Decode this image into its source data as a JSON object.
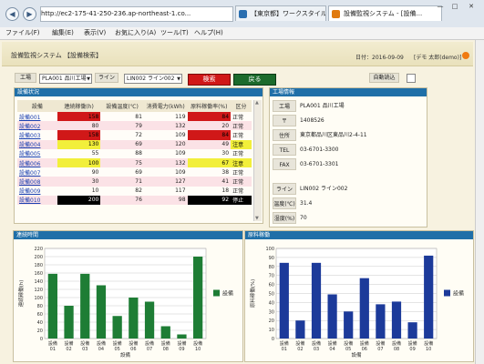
{
  "browser": {
    "address": "http://ec2-175-41-250-236.ap-northeast-1.co...",
    "tabs": [
      {
        "label": "【東京都】ワークスタイル..."
      },
      {
        "label": "設備監視システム - [設備..."
      }
    ],
    "menu": [
      "ファイル(F)",
      "編集(E)",
      "表示(V)",
      "お気に入り(A)",
      "ツール(T)",
      "ヘルプ(H)"
    ]
  },
  "header": {
    "title": "設備監視システム 【設備検索】",
    "date_label": "日付：2016-09-09",
    "user_label": "[デモ 太郎(demo)]"
  },
  "filters": {
    "factory_label": "工場",
    "factory_value": "PLA001 品川工場",
    "line_label": "ライン",
    "line_value": "LIN002 ライン002",
    "search_button": "検索",
    "back_button": "戻る",
    "auto_refresh_label": "自動読込"
  },
  "status_panel": {
    "title": "設備状況",
    "columns": [
      "設備",
      "連続稼働(h)",
      "設備温度(℃)",
      "消費電力(kWh)",
      "原料稼働率(%)",
      "区分"
    ],
    "rows": [
      {
        "name": "設備001",
        "hours": 158,
        "temp": "81",
        "power": "119",
        "rate": 84,
        "status": "正常"
      },
      {
        "name": "設備002",
        "hours": 80,
        "temp": "79",
        "power": "132",
        "rate": 20,
        "status": "正常"
      },
      {
        "name": "設備003",
        "hours": 158,
        "temp": "72",
        "power": "109",
        "rate": 84,
        "status": "正常"
      },
      {
        "name": "設備004",
        "hours": 130,
        "temp": "69",
        "power": "120",
        "rate": 49,
        "status": "注意"
      },
      {
        "name": "設備005",
        "hours": 55,
        "temp": "88",
        "power": "109",
        "rate": 30,
        "status": "正常"
      },
      {
        "name": "設備006",
        "hours": 100,
        "temp": "75",
        "power": "132",
        "rate": 67,
        "status": "注意"
      },
      {
        "name": "設備007",
        "hours": 90,
        "temp": "69",
        "power": "109",
        "rate": 38,
        "status": "正常"
      },
      {
        "name": "設備008",
        "hours": 30,
        "temp": "71",
        "power": "127",
        "rate": 41,
        "status": "正常"
      },
      {
        "name": "設備009",
        "hours": 10,
        "temp": "82",
        "power": "117",
        "rate": 18,
        "status": "正常"
      },
      {
        "name": "設備010",
        "hours": 200,
        "temp": "76",
        "power": "98",
        "rate": 92,
        "status": "停止"
      }
    ]
  },
  "factory_panel": {
    "title": "工場情報",
    "fields": [
      {
        "label": "工場",
        "value": "PLA001 品川工場"
      },
      {
        "label": "〒",
        "value": "1408526"
      },
      {
        "label": "住所",
        "value": "東京都品川区東品川2-4-11"
      },
      {
        "label": "TEL",
        "value": "03-6701-3300"
      },
      {
        "label": "FAX",
        "value": "03-6701-3301"
      }
    ],
    "line_fields": [
      {
        "label": "ライン",
        "value": "LIN002 ライン002"
      },
      {
        "label": "温度(℃)",
        "value": "31.4"
      },
      {
        "label": "湿度(%)",
        "value": "70"
      }
    ]
  },
  "chart_data": [
    {
      "type": "bar",
      "title": "連続時間",
      "ylabel": "連続稼働(h)",
      "xlabel": "設備",
      "legend": "設備",
      "legend_position": "right",
      "color": "#1e7d35",
      "categories": [
        "設備01",
        "設備02",
        "設備03",
        "設備04",
        "設備05",
        "設備06",
        "設備07",
        "設備08",
        "設備09",
        "設備10"
      ],
      "values": [
        158,
        80,
        158,
        130,
        55,
        100,
        90,
        30,
        10,
        200
      ],
      "yticks": [
        "0",
        "20",
        "40",
        "60",
        "80",
        "100",
        "120",
        "140",
        "160",
        "180",
        "200",
        "220"
      ],
      "ylim": [
        0,
        220
      ]
    },
    {
      "type": "bar",
      "title": "原料稼働",
      "ylabel": "原料稼働(%)",
      "xlabel": "設備",
      "legend": "設備",
      "legend_position": "right",
      "color": "#1c3a9a",
      "categories": [
        "設備01",
        "設備02",
        "設備03",
        "設備04",
        "設備05",
        "設備06",
        "設備07",
        "設備08",
        "設備09",
        "設備10"
      ],
      "values": [
        84,
        20,
        84,
        49,
        30,
        67,
        38,
        41,
        18,
        92
      ],
      "yticks": [
        "0",
        "10",
        "20",
        "30",
        "40",
        "50",
        "60",
        "70",
        "80",
        "90",
        "100"
      ],
      "ylim": [
        0,
        100
      ]
    }
  ]
}
